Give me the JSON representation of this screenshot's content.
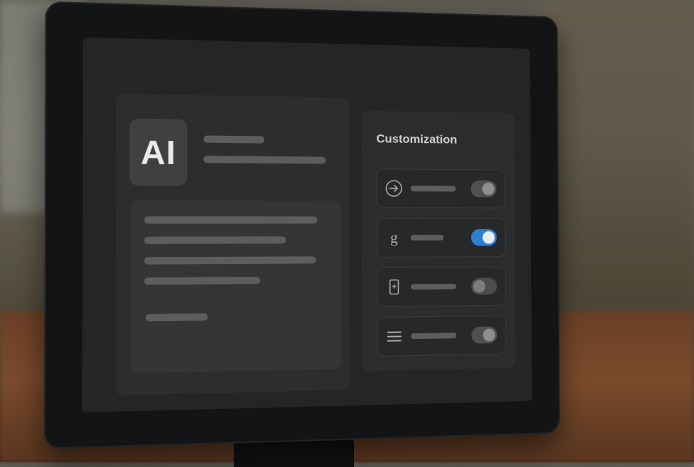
{
  "app": {
    "logo_text": "AI"
  },
  "customization_panel": {
    "title": "Customization",
    "rows": [
      {
        "icon": "arrow-right-circle-icon",
        "state": "on-dim"
      },
      {
        "icon": "google-g-icon",
        "state": "on"
      },
      {
        "icon": "mobile-device-icon",
        "state": "off"
      },
      {
        "icon": "menu-lines-icon",
        "state": "on-dim"
      }
    ]
  },
  "colors": {
    "toggle_on": "#2f7fd1",
    "panel": "#2a2c2e",
    "screen": "#232526"
  }
}
